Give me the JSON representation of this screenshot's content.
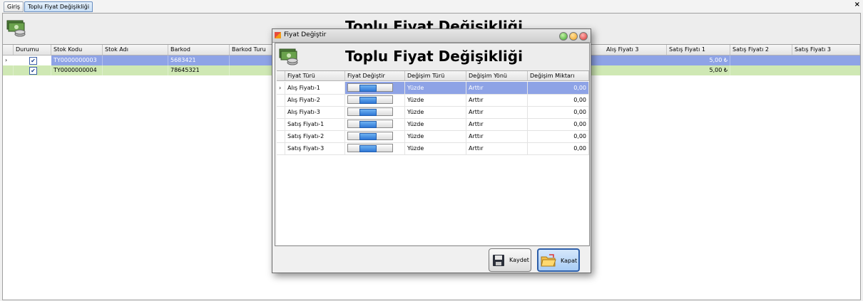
{
  "tabs": [
    {
      "label": "Giriş",
      "active": false
    },
    {
      "label": "Toplu Fiyat Değişikliği",
      "active": true
    }
  ],
  "main": {
    "title": "Toplu Fiyat Değişikliği",
    "columns": [
      "Durumu",
      "Stok Kodu",
      "Stok Adı",
      "Barkod",
      "Barkod Turu",
      "Alış Fiyatı 3",
      "Satış Fiyatı 1",
      "Satış Fiyatı 2",
      "Satış Fiyatı 3"
    ],
    "rows": [
      {
        "durumu": true,
        "stok_kodu": "TY0000000003",
        "stok_adi": "",
        "barkod": "5683421",
        "satis_fiyati_1": "5,00 ₺",
        "selected": true
      },
      {
        "durumu": true,
        "stok_kodu": "TY0000000004",
        "stok_adi": "",
        "barkod": "78645321",
        "satis_fiyati_1": "5,00 ₺",
        "selected": false
      }
    ]
  },
  "dialog": {
    "title": "Fiyat Değiştir",
    "heading": "Toplu Fiyat Değişikliği",
    "columns": [
      "Fiyat Türü",
      "Fiyat Değiştir",
      "Değişim Türü",
      "Değişim Yönü",
      "Değişim Miktarı"
    ],
    "rows": [
      {
        "fiyat_turu": "Alış Fiyatı-1",
        "degisim_turu": "Yüzde",
        "degisim_yonu": "Arttır",
        "miktar": "0,00"
      },
      {
        "fiyat_turu": "Alış Fiyatı-2",
        "degisim_turu": "Yüzde",
        "degisim_yonu": "Arttır",
        "miktar": "0,00"
      },
      {
        "fiyat_turu": "Alış Fiyatı-3",
        "degisim_turu": "Yüzde",
        "degisim_yonu": "Arttır",
        "miktar": "0,00"
      },
      {
        "fiyat_turu": "Satış Fiyatı-1",
        "degisim_turu": "Yüzde",
        "degisim_yonu": "Arttır",
        "miktar": "0,00"
      },
      {
        "fiyat_turu": "Satış Fiyatı-2",
        "degisim_turu": "Yüzde",
        "degisim_yonu": "Arttır",
        "miktar": "0,00"
      },
      {
        "fiyat_turu": "Satış Fiyatı-3",
        "degisim_turu": "Yüzde",
        "degisim_yonu": "Arttır",
        "miktar": "0,00"
      }
    ],
    "buttons": {
      "save": "Kaydet",
      "close": "Kapat"
    }
  },
  "icons": {
    "money": "money-stack-icon",
    "save": "floppy-disk-icon",
    "close": "folder-exit-icon"
  }
}
